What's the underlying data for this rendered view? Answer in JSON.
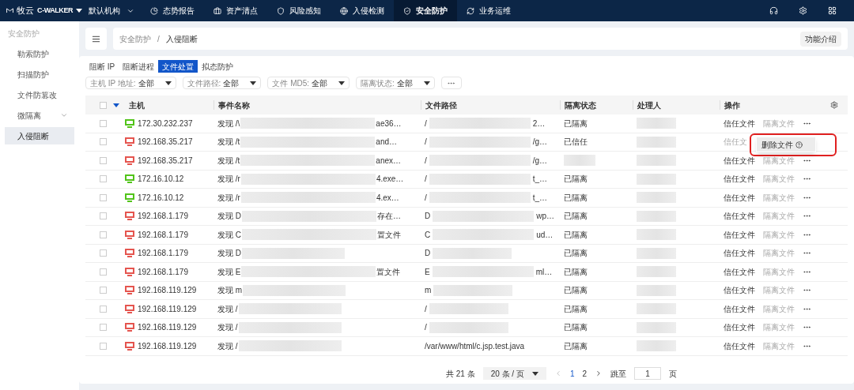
{
  "brand": {
    "name": "牧云",
    "sub": "C-WALKER"
  },
  "org": "默认机构",
  "nav": [
    {
      "label": "态势报告",
      "selected": false
    },
    {
      "label": "资产清点",
      "selected": false
    },
    {
      "label": "风险感知",
      "selected": false
    },
    {
      "label": "入侵检测",
      "selected": false
    },
    {
      "label": "安全防护",
      "selected": true
    },
    {
      "label": "业务运维",
      "selected": false
    }
  ],
  "sidebar": {
    "title": "安全防护",
    "items": [
      {
        "label": "勒索防护",
        "selected": false
      },
      {
        "label": "扫描防护",
        "selected": false
      },
      {
        "label": "文件防篡改",
        "selected": false
      },
      {
        "label": "微隔离",
        "selected": false,
        "expandable": true
      },
      {
        "label": "入侵阻断",
        "selected": true
      }
    ]
  },
  "breadcrumb": {
    "items": [
      "安全防护",
      "入侵阻断"
    ],
    "separator": "/"
  },
  "intro_button": "功能介绍",
  "tabs": [
    {
      "label": "阻断 IP",
      "selected": false
    },
    {
      "label": "阻断进程",
      "selected": false
    },
    {
      "label": "文件处置",
      "selected": true
    },
    {
      "label": "拟态防护",
      "selected": false
    }
  ],
  "filters": [
    {
      "label": "主机 IP 地址:",
      "value": "全部"
    },
    {
      "label": "文件路径:",
      "value": "全部"
    },
    {
      "label": "文件 MD5:",
      "value": "全部"
    },
    {
      "label": "隔离状态:",
      "value": "全部"
    }
  ],
  "table": {
    "columns": [
      "主机",
      "事件名称",
      "文件路径",
      "隔离状态",
      "处理人",
      "操作"
    ],
    "all_checked": false,
    "rows": [
      {
        "checked": false,
        "host": "172.30.232.237",
        "color": "#52c41a",
        "event": "发现 /\\",
        "event_tail": "ae36…",
        "path": "/",
        "path_tail": "2…",
        "status": "已隔离",
        "actions": [
          {
            "label": "信任文件",
            "disabled": false
          },
          {
            "label": "隔离文件",
            "disabled": true
          }
        ]
      },
      {
        "checked": false,
        "host": "192.168.35.217",
        "color": "#e5554f",
        "event": "发现 /t",
        "event_tail": "and…",
        "path": "/",
        "path_tail": "/g…",
        "status": "已信任",
        "actions": [
          {
            "label": "信任文",
            "disabled": true
          }
        ],
        "menu_open": true
      },
      {
        "checked": false,
        "host": "192.168.35.217",
        "color": "#e5554f",
        "event": "发现 /t",
        "event_tail": "anex…",
        "path": "/",
        "path_tail": "/g…",
        "actions": [
          {
            "label": "信任文件",
            "disabled": false
          },
          {
            "label": "隔离文件",
            "disabled": true
          }
        ]
      },
      {
        "checked": false,
        "host": "172.16.10.12",
        "color": "#52c41a",
        "event": "发现 /r",
        "event_tail": "4.exe…",
        "path": "/",
        "path_tail": "t_…",
        "status": "已隔离",
        "actions": [
          {
            "label": "信任文件",
            "disabled": false
          },
          {
            "label": "隔离文件",
            "disabled": true
          }
        ]
      },
      {
        "checked": false,
        "host": "172.16.10.12",
        "color": "#52c41a",
        "event": "发现 /r",
        "event_tail": "4.ex…",
        "path": "/",
        "path_tail": "t_…",
        "status": "已隔离",
        "actions": [
          {
            "label": "信任文件",
            "disabled": false
          },
          {
            "label": "隔离文件",
            "disabled": true
          }
        ]
      },
      {
        "checked": false,
        "host": "192.168.1.179",
        "color": "#e5554f",
        "event": "发现 D",
        "event_tail": "存在…",
        "path": "D",
        "path_tail": "wp…",
        "status": "已隔离",
        "actions": [
          {
            "label": "信任文件",
            "disabled": false
          },
          {
            "label": "隔离文件",
            "disabled": true
          }
        ]
      },
      {
        "checked": false,
        "host": "192.168.1.179",
        "color": "#e5554f",
        "event": "发现 C",
        "event_tail": "置文件",
        "path": "C",
        "path_tail": "ud…",
        "status": "已隔离",
        "actions": [
          {
            "label": "信任文件",
            "disabled": false
          },
          {
            "label": "隔离文件",
            "disabled": true
          }
        ]
      },
      {
        "checked": false,
        "host": "192.168.1.179",
        "color": "#e5554f",
        "event": "发现 D",
        "path": "D",
        "status": "已隔离",
        "actions": [
          {
            "label": "信任文件",
            "disabled": false
          },
          {
            "label": "隔离文件",
            "disabled": true
          }
        ]
      },
      {
        "checked": false,
        "host": "192.168.1.179",
        "color": "#e5554f",
        "event": "发现 E",
        "event_tail": "置文件",
        "path": "E",
        "path_tail": "ml…",
        "status": "已隔离",
        "actions": [
          {
            "label": "信任文件",
            "disabled": false
          },
          {
            "label": "隔离文件",
            "disabled": true
          }
        ]
      },
      {
        "checked": false,
        "host": "192.168.119.129",
        "color": "#e5554f",
        "event": "发现 m",
        "path": "m",
        "status": "已隔离",
        "actions": [
          {
            "label": "信任文件",
            "disabled": false
          },
          {
            "label": "隔离文件",
            "disabled": true
          }
        ]
      },
      {
        "checked": false,
        "host": "192.168.119.129",
        "color": "#e5554f",
        "event": "发现 /",
        "path": "/",
        "status": "已隔离",
        "actions": [
          {
            "label": "信任文件",
            "disabled": false
          },
          {
            "label": "隔离文件",
            "disabled": true
          }
        ]
      },
      {
        "checked": false,
        "host": "192.168.119.129",
        "color": "#e5554f",
        "event": "发现 /",
        "path": "/",
        "status": "已隔离",
        "actions": [
          {
            "label": "信任文件",
            "disabled": false
          },
          {
            "label": "隔离文件",
            "disabled": true
          }
        ]
      },
      {
        "checked": false,
        "host": "192.168.119.129",
        "color": "#e5554f",
        "event": "发现 /",
        "path": "/var/www/html/c.jsp.test.java",
        "status": "已隔离",
        "actions": [
          {
            "label": "信任文件",
            "disabled": false
          },
          {
            "label": "隔离文件",
            "disabled": true
          }
        ]
      }
    ]
  },
  "dropdown": {
    "items": [
      "删除文件"
    ]
  },
  "pagination": {
    "total": "共 21 条",
    "page_size": "20 条 / 页",
    "pages": [
      {
        "label": "1",
        "selected": true
      },
      {
        "label": "2",
        "selected": false
      }
    ],
    "jump_label": "跳至",
    "jump_value": "1",
    "jump_unit": "页"
  }
}
